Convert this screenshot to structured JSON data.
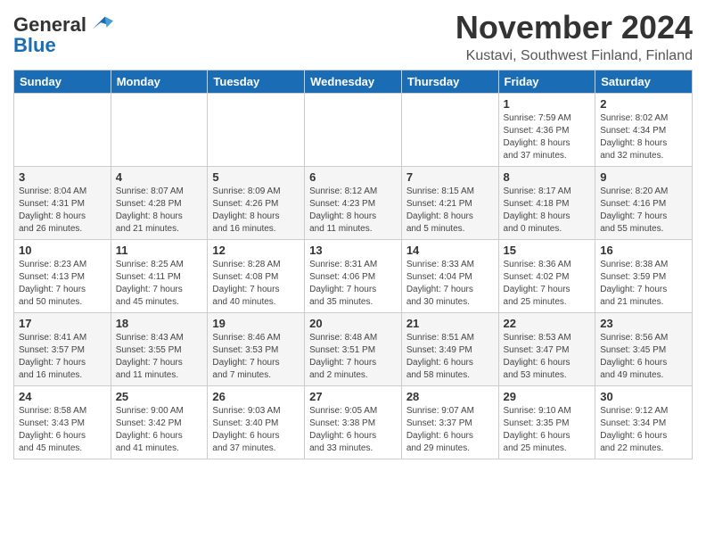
{
  "header": {
    "logo_line1": "General",
    "logo_line2": "Blue",
    "title": "November 2024",
    "subtitle": "Kustavi, Southwest Finland, Finland"
  },
  "calendar": {
    "weekdays": [
      "Sunday",
      "Monday",
      "Tuesday",
      "Wednesday",
      "Thursday",
      "Friday",
      "Saturday"
    ],
    "rows": [
      {
        "shade": "white",
        "days": [
          {
            "num": "",
            "info": ""
          },
          {
            "num": "",
            "info": ""
          },
          {
            "num": "",
            "info": ""
          },
          {
            "num": "",
            "info": ""
          },
          {
            "num": "",
            "info": ""
          },
          {
            "num": "1",
            "info": "Sunrise: 7:59 AM\nSunset: 4:36 PM\nDaylight: 8 hours\nand 37 minutes."
          },
          {
            "num": "2",
            "info": "Sunrise: 8:02 AM\nSunset: 4:34 PM\nDaylight: 8 hours\nand 32 minutes."
          }
        ]
      },
      {
        "shade": "shaded",
        "days": [
          {
            "num": "3",
            "info": "Sunrise: 8:04 AM\nSunset: 4:31 PM\nDaylight: 8 hours\nand 26 minutes."
          },
          {
            "num": "4",
            "info": "Sunrise: 8:07 AM\nSunset: 4:28 PM\nDaylight: 8 hours\nand 21 minutes."
          },
          {
            "num": "5",
            "info": "Sunrise: 8:09 AM\nSunset: 4:26 PM\nDaylight: 8 hours\nand 16 minutes."
          },
          {
            "num": "6",
            "info": "Sunrise: 8:12 AM\nSunset: 4:23 PM\nDaylight: 8 hours\nand 11 minutes."
          },
          {
            "num": "7",
            "info": "Sunrise: 8:15 AM\nSunset: 4:21 PM\nDaylight: 8 hours\nand 5 minutes."
          },
          {
            "num": "8",
            "info": "Sunrise: 8:17 AM\nSunset: 4:18 PM\nDaylight: 8 hours\nand 0 minutes."
          },
          {
            "num": "9",
            "info": "Sunrise: 8:20 AM\nSunset: 4:16 PM\nDaylight: 7 hours\nand 55 minutes."
          }
        ]
      },
      {
        "shade": "white",
        "days": [
          {
            "num": "10",
            "info": "Sunrise: 8:23 AM\nSunset: 4:13 PM\nDaylight: 7 hours\nand 50 minutes."
          },
          {
            "num": "11",
            "info": "Sunrise: 8:25 AM\nSunset: 4:11 PM\nDaylight: 7 hours\nand 45 minutes."
          },
          {
            "num": "12",
            "info": "Sunrise: 8:28 AM\nSunset: 4:08 PM\nDaylight: 7 hours\nand 40 minutes."
          },
          {
            "num": "13",
            "info": "Sunrise: 8:31 AM\nSunset: 4:06 PM\nDaylight: 7 hours\nand 35 minutes."
          },
          {
            "num": "14",
            "info": "Sunrise: 8:33 AM\nSunset: 4:04 PM\nDaylight: 7 hours\nand 30 minutes."
          },
          {
            "num": "15",
            "info": "Sunrise: 8:36 AM\nSunset: 4:02 PM\nDaylight: 7 hours\nand 25 minutes."
          },
          {
            "num": "16",
            "info": "Sunrise: 8:38 AM\nSunset: 3:59 PM\nDaylight: 7 hours\nand 21 minutes."
          }
        ]
      },
      {
        "shade": "shaded",
        "days": [
          {
            "num": "17",
            "info": "Sunrise: 8:41 AM\nSunset: 3:57 PM\nDaylight: 7 hours\nand 16 minutes."
          },
          {
            "num": "18",
            "info": "Sunrise: 8:43 AM\nSunset: 3:55 PM\nDaylight: 7 hours\nand 11 minutes."
          },
          {
            "num": "19",
            "info": "Sunrise: 8:46 AM\nSunset: 3:53 PM\nDaylight: 7 hours\nand 7 minutes."
          },
          {
            "num": "20",
            "info": "Sunrise: 8:48 AM\nSunset: 3:51 PM\nDaylight: 7 hours\nand 2 minutes."
          },
          {
            "num": "21",
            "info": "Sunrise: 8:51 AM\nSunset: 3:49 PM\nDaylight: 6 hours\nand 58 minutes."
          },
          {
            "num": "22",
            "info": "Sunrise: 8:53 AM\nSunset: 3:47 PM\nDaylight: 6 hours\nand 53 minutes."
          },
          {
            "num": "23",
            "info": "Sunrise: 8:56 AM\nSunset: 3:45 PM\nDaylight: 6 hours\nand 49 minutes."
          }
        ]
      },
      {
        "shade": "white",
        "days": [
          {
            "num": "24",
            "info": "Sunrise: 8:58 AM\nSunset: 3:43 PM\nDaylight: 6 hours\nand 45 minutes."
          },
          {
            "num": "25",
            "info": "Sunrise: 9:00 AM\nSunset: 3:42 PM\nDaylight: 6 hours\nand 41 minutes."
          },
          {
            "num": "26",
            "info": "Sunrise: 9:03 AM\nSunset: 3:40 PM\nDaylight: 6 hours\nand 37 minutes."
          },
          {
            "num": "27",
            "info": "Sunrise: 9:05 AM\nSunset: 3:38 PM\nDaylight: 6 hours\nand 33 minutes."
          },
          {
            "num": "28",
            "info": "Sunrise: 9:07 AM\nSunset: 3:37 PM\nDaylight: 6 hours\nand 29 minutes."
          },
          {
            "num": "29",
            "info": "Sunrise: 9:10 AM\nSunset: 3:35 PM\nDaylight: 6 hours\nand 25 minutes."
          },
          {
            "num": "30",
            "info": "Sunrise: 9:12 AM\nSunset: 3:34 PM\nDaylight: 6 hours\nand 22 minutes."
          }
        ]
      }
    ]
  }
}
